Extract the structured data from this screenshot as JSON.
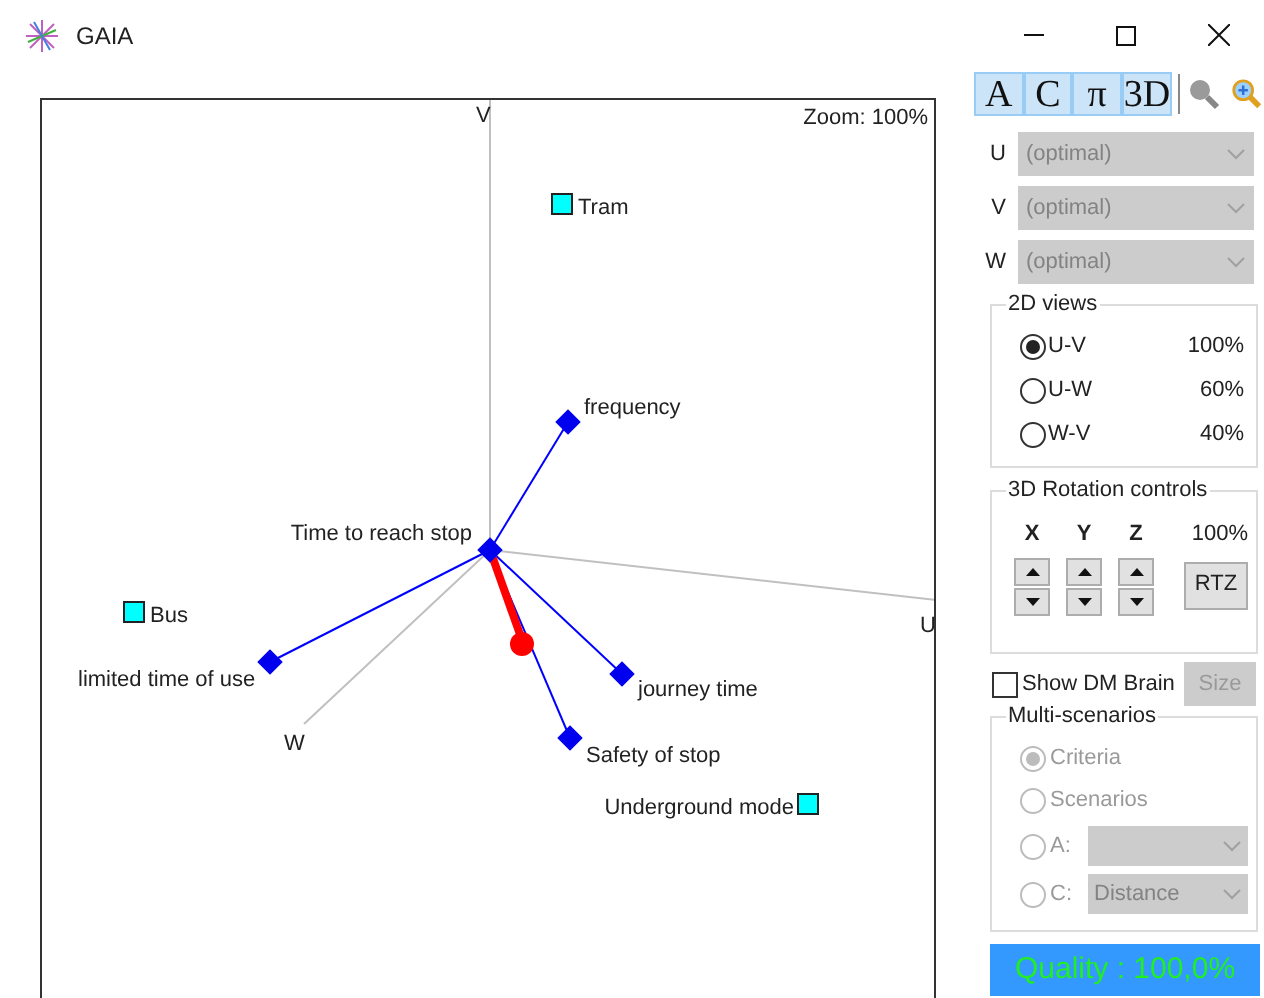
{
  "window": {
    "title": "GAIA"
  },
  "toolbar": [
    {
      "label": "A",
      "kind": "toggle"
    },
    {
      "label": "C",
      "kind": "toggle"
    },
    {
      "label": "π",
      "kind": "toggle"
    },
    {
      "label": "3D",
      "kind": "toggle"
    },
    {
      "kind": "zoom-out"
    },
    {
      "kind": "zoom-in"
    }
  ],
  "plot": {
    "zoom": "Zoom: 100%",
    "axes": [
      {
        "label": "V"
      },
      {
        "label": "U"
      },
      {
        "label": "W"
      }
    ],
    "criteria": [
      {
        "label": "frequency"
      },
      {
        "label": "Time to reach stop"
      },
      {
        "label": "limited time of use"
      },
      {
        "label": "journey time"
      },
      {
        "label": "Safety of stop"
      }
    ],
    "alternatives": [
      {
        "label": "Tram"
      },
      {
        "label": "Bus"
      },
      {
        "label": "Underground mode"
      }
    ]
  },
  "axis_selects": [
    {
      "label": "U",
      "value": "(optimal)",
      "disabled": true
    },
    {
      "label": "V",
      "value": "(optimal)",
      "disabled": true
    },
    {
      "label": "W",
      "value": "(optimal)",
      "disabled": true
    }
  ],
  "views_2d": {
    "title": "2D views",
    "items": [
      {
        "label": "U-V",
        "value": "100%",
        "selected": true
      },
      {
        "label": "U-W",
        "value": "60%",
        "selected": false
      },
      {
        "label": "W-V",
        "value": "40%",
        "selected": false
      }
    ]
  },
  "rotation": {
    "title": "3D Rotation controls",
    "axes": [
      "X",
      "Y",
      "Z"
    ],
    "value": "100%",
    "button": "RTZ"
  },
  "dm_brain": {
    "label": "Show DM Brain",
    "checked": false,
    "button": "Size",
    "button_disabled": true
  },
  "multi_scenarios": {
    "title": "Multi-scenarios",
    "items": [
      {
        "label": "Criteria",
        "kind": "radio",
        "selected": true,
        "disabled": true
      },
      {
        "label": "Scenarios",
        "kind": "radio",
        "selected": false,
        "disabled": true
      },
      {
        "label": "A:",
        "kind": "radio-select",
        "selected": false,
        "disabled": true
      },
      {
        "label": "C:",
        "kind": "radio-select",
        "selected": false,
        "disabled": true,
        "value": "Distance"
      }
    ]
  },
  "quality": "Quality : 100,0%"
}
